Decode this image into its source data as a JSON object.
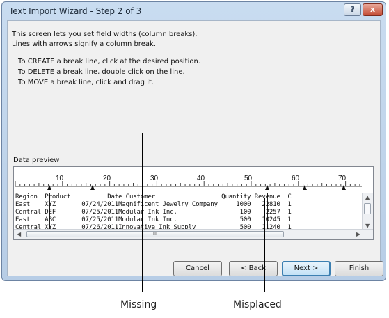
{
  "window": {
    "title": "Text Import Wizard - Step 2 of 3",
    "help_glyph": "?",
    "close_glyph": "x"
  },
  "instructions": {
    "line1": "This screen lets you set field widths (column breaks).",
    "line2": "Lines with arrows signify a column break.",
    "create": "To CREATE a break line, click at the desired position.",
    "delete": "To DELETE a break line, double click on the line.",
    "move": "To MOVE a break line, click and drag it."
  },
  "preview": {
    "label": "Data preview",
    "ruler_labels": [
      "10",
      "20",
      "30",
      "40",
      "50",
      "60",
      "70"
    ],
    "rows": [
      "Region  Product          Date Customer                  Quantity Revenue  C",
      "East    XYZ       07/24/2011Magnificent Jewelry Company     1000   22810  1",
      "Central DEF       07/25/2011Modular Ink Inc.                 100    2257  1",
      "East    ABC       07/25/2011Modular Ink Inc.                 500   10245  1",
      "Central XYZ       07/26/2011Innovative Ink Supply            500   11240  1"
    ],
    "hscroll_grip": "III"
  },
  "buttons": {
    "cancel": "Cancel",
    "back": "< Back",
    "next": "Next >",
    "finish": "Finish"
  },
  "callouts": {
    "missing": "Missing",
    "misplaced": "Misplaced"
  }
}
